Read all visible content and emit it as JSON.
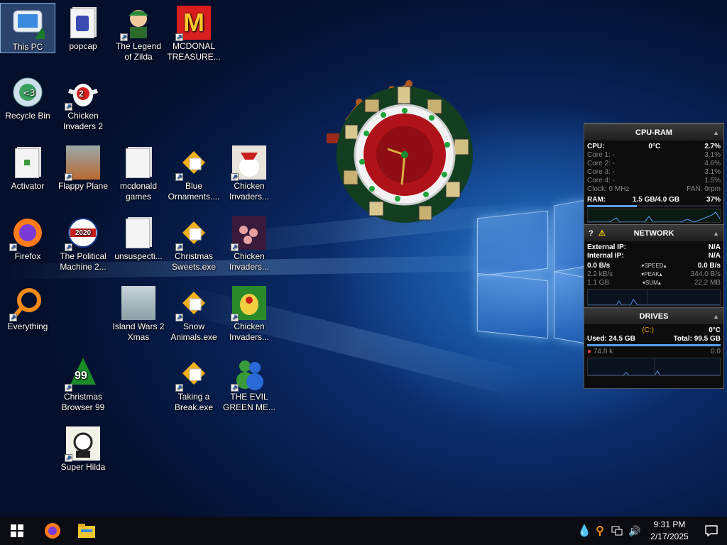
{
  "desktop": {
    "icons": [
      {
        "label": "This PC"
      },
      {
        "label": "popcap"
      },
      {
        "label": "The Legend of Zilda"
      },
      {
        "label": "MCDONAL TREASURE..."
      },
      {
        "label": "Recycle Bin"
      },
      {
        "label": "Chicken Invaders 2"
      },
      {
        "label": "Activator"
      },
      {
        "label": "Flappy Plane"
      },
      {
        "label": "mcdonald games"
      },
      {
        "label": "Blue Ornaments...."
      },
      {
        "label": "Chicken Invaders..."
      },
      {
        "label": "Firefox"
      },
      {
        "label": "The Political Machine 2..."
      },
      {
        "label": "unsuspecti..."
      },
      {
        "label": "Christmas Sweets.exe"
      },
      {
        "label": "Chicken Invaders..."
      },
      {
        "label": "Everything"
      },
      {
        "label": "Island Wars 2 Xmas"
      },
      {
        "label": "Snow Animals.exe"
      },
      {
        "label": "Chicken Invaders..."
      },
      {
        "label": "Christmas Browser 99"
      },
      {
        "label": "Taking a Break.exe"
      },
      {
        "label": "THE EVIL GREEN ME..."
      },
      {
        "label": "Super Hilda"
      }
    ],
    "badges": {
      "chicken2": "2",
      "political": "2020",
      "browser99": "99",
      "mcd": "M"
    }
  },
  "widget": {
    "cpu_ram": {
      "title": "CPU-RAM",
      "cpu_label": "CPU:",
      "cpu_temp": "0°C",
      "cpu_pct": "2.7%",
      "cores": [
        {
          "label": "Core 1:",
          "val": "-",
          "pct": "3.1%"
        },
        {
          "label": "Core 2:",
          "val": "-",
          "pct": "4.6%"
        },
        {
          "label": "Core 3:",
          "val": "-",
          "pct": "3.1%"
        },
        {
          "label": "Core 4:",
          "val": "-",
          "pct": "1.5%"
        }
      ],
      "clock": "Clock: 0 MHz",
      "fan": "FAN: 0rpm",
      "ram_label": "RAM:",
      "ram_val": "1.5 GB/4.0 GB",
      "ram_pct": "37%",
      "ram_fraction": 0.37
    },
    "network": {
      "title": "NETWORK",
      "external_label": "External IP:",
      "external_val": "N/A",
      "internal_label": "Internal IP:",
      "internal_val": "N/A",
      "speed_left": "0.0 B/s",
      "speed_label": "SPEED",
      "speed_right": "0.0 B/s",
      "peak_left": "2.2 kB/s",
      "peak_label": "PEAK",
      "peak_right": "344.0 B/s",
      "sum_left": "1.1 GB",
      "sum_label": "SUM",
      "sum_right": "22.2 MB"
    },
    "drives": {
      "title": "DRIVES",
      "drive": "(C:)",
      "temp": "0°C",
      "used": "Used: 24.5 GB",
      "total": "Total: 99.5 GB",
      "read": "74.8 k",
      "write": "0.0"
    }
  },
  "taskbar": {
    "time": "9:31 PM",
    "date": "2/17/2025"
  },
  "colors": {
    "accent": "#ffaa00",
    "graph": "#5aa0ff",
    "alert": "#ff4444"
  }
}
